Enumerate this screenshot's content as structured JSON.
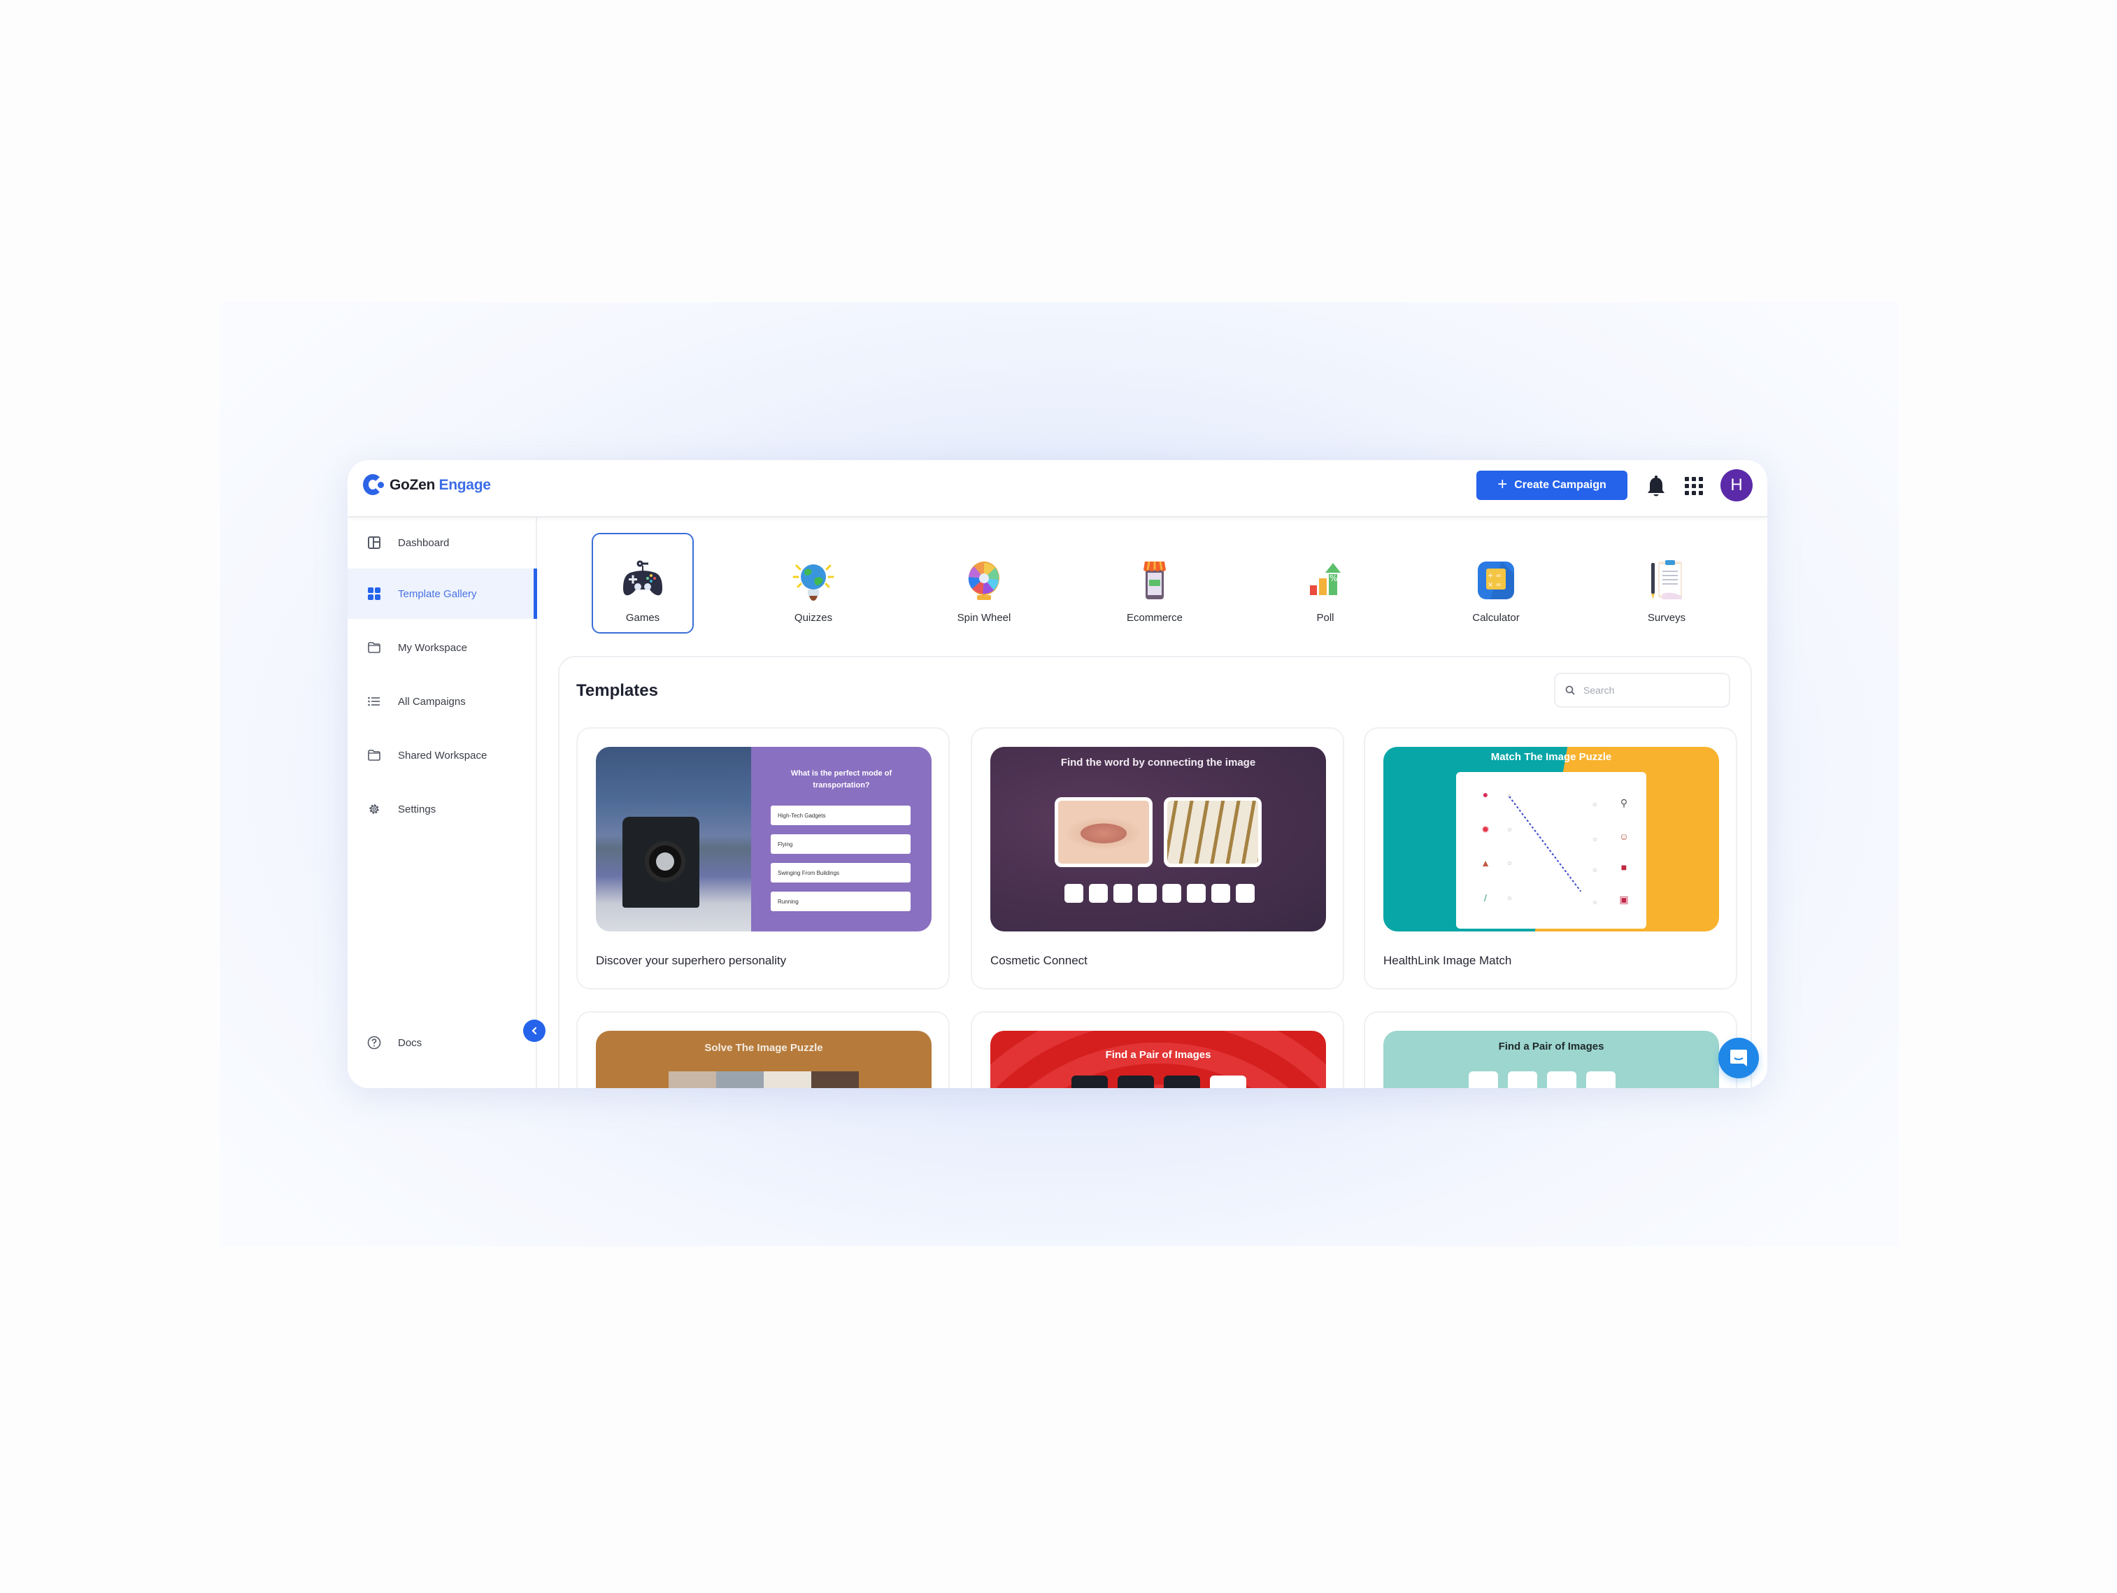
{
  "app": {
    "brand_primary": "GoZen",
    "brand_secondary": "Engage",
    "accent_color": "#2563eb"
  },
  "header": {
    "create_button_label": "Create Campaign",
    "create_button_icon": "plus-icon",
    "notification_icon": "bell-icon",
    "apps_icon": "grid-icon",
    "avatar_initial": "H",
    "avatar_color": "#5b2aa8"
  },
  "sidebar": {
    "items": [
      {
        "label": "Dashboard",
        "icon": "dashboard-icon",
        "active": false
      },
      {
        "label": "Template Gallery",
        "icon": "grid-icon",
        "active": true
      },
      {
        "label": "My Workspace",
        "icon": "folder-icon",
        "active": false
      },
      {
        "label": "All Campaigns",
        "icon": "list-icon",
        "active": false
      },
      {
        "label": "Shared Workspace",
        "icon": "folder-icon",
        "active": false
      },
      {
        "label": "Settings",
        "icon": "gear-icon",
        "active": false
      }
    ],
    "footer_item": {
      "label": "Docs",
      "icon": "help-circle-icon"
    },
    "collapse_icon": "chevron-left-icon"
  },
  "categories": [
    {
      "label": "Games",
      "icon": "gamepad-icon",
      "selected": true
    },
    {
      "label": "Quizzes",
      "icon": "lightbulb-globe-icon",
      "selected": false
    },
    {
      "label": "Spin Wheel",
      "icon": "spin-wheel-icon",
      "selected": false
    },
    {
      "label": "Ecommerce",
      "icon": "shop-icon",
      "selected": false
    },
    {
      "label": "Poll",
      "icon": "bar-chart-icon",
      "selected": false
    },
    {
      "label": "Calculator",
      "icon": "calculator-icon",
      "selected": false
    },
    {
      "label": "Surveys",
      "icon": "clipboard-icon",
      "selected": false
    }
  ],
  "templates": {
    "title": "Templates",
    "search_placeholder": "Search",
    "search_value": "",
    "cards": [
      {
        "name": "Discover your superhero personality",
        "preview": {
          "question": "What is the perfect mode of transportation?",
          "options": [
            "High-Tech Gadgets",
            "Flying",
            "Swinging From Buildings",
            "Running"
          ]
        }
      },
      {
        "name": "Cosmetic Connect",
        "preview": {
          "title": "Find the word by connecting the image",
          "letter_slots": 8
        }
      },
      {
        "name": "HealthLink Image Match",
        "preview": {
          "title": "Match The Image Puzzle"
        }
      },
      {
        "name": "",
        "preview": {
          "title": "Solve The Image Puzzle"
        }
      },
      {
        "name": "",
        "preview": {
          "title": "Find a Pair of Images"
        }
      },
      {
        "name": "",
        "preview": {
          "title": "Find a Pair of Images"
        }
      }
    ]
  },
  "support": {
    "chat_icon": "chat-bubble-icon"
  }
}
